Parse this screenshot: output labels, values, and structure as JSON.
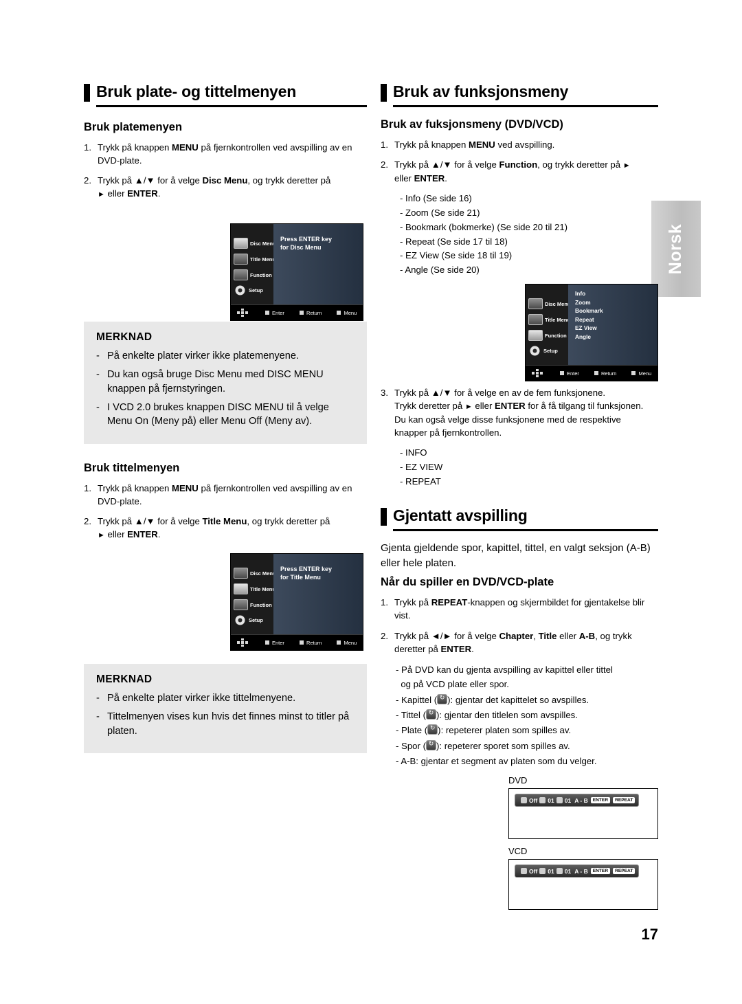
{
  "side_tab": {
    "label": "Norsk"
  },
  "page_number": "17",
  "left": {
    "title": "Bruk plate- og tittelmenyen",
    "sub1": "Bruk platemenyen",
    "steps1": [
      {
        "num": "1.",
        "text": "Trykk på knappen MENU på fjernkontrollen ved avspilling av en DVD-plate.",
        "bold": "MENU"
      },
      {
        "num": "2.",
        "text": "Trykk på ▲/▼ for å velge Disc Menu, og trykk deretter på ► eller ENTER."
      }
    ],
    "osd1": {
      "menu_items": [
        "Disc Menu",
        "Title Menu",
        "Function",
        "Setup"
      ],
      "panel_line1": "Press ENTER key",
      "panel_line2": "for Disc Menu",
      "footer": [
        "Enter",
        "Return",
        "Menu"
      ]
    },
    "note1": {
      "title": "MERKNAD",
      "items": [
        "På enkelte plater virker ikke platemenyene.",
        "Du kan også bruge Disc Menu med DISC MENU knappen på fjernstyringen.",
        "I VCD 2.0 brukes knappen DISC MENU til å velge Menu On (Meny på) eller Menu Off (Meny av)."
      ]
    },
    "sub2": "Bruk tittelmenyen",
    "steps2": [
      {
        "num": "1.",
        "text": "Trykk på knappen MENU på fjernkontrollen ved avspilling av en DVD-plate."
      },
      {
        "num": "2.",
        "text": "Trykk på ▲/▼ for å velge Title Menu, og trykk deretter på ► eller ENTER."
      }
    ],
    "osd2": {
      "menu_items": [
        "Disc Menu",
        "Title Menu",
        "Function",
        "Setup"
      ],
      "panel_line1": "Press ENTER key",
      "panel_line2": "for Title Menu",
      "footer": [
        "Enter",
        "Return",
        "Menu"
      ]
    },
    "note2": {
      "title": "MERKNAD",
      "items": [
        "På enkelte plater virker ikke tittelmenyene.",
        "Tittelmenyen vises kun hvis det finnes minst to titler på platen."
      ]
    }
  },
  "right": {
    "title": "Bruk av funksjonsmeny",
    "sub1": "Bruk av fuksjonsmeny (DVD/VCD)",
    "step1": {
      "num": "1.",
      "text": "Trykk på knappen MENU ved avspilling."
    },
    "step2": {
      "num": "2.",
      "text": "Trykk på ▲/▼ for å velge Function, og trykk deretter på ► eller ENTER."
    },
    "function_list": [
      "- Info (Se side 16)",
      "- Zoom (Se side 21)",
      "- Bookmark (bokmerke) (Se side 20 til 21)",
      "- Repeat (Se side 17 til 18)",
      "- EZ View (Se side 18 til 19)",
      "- Angle (Se side 20)"
    ],
    "osd3": {
      "menu_items": [
        "Disc Menu",
        "Title Menu",
        "Function",
        "Setup"
      ],
      "list_items": [
        "Info",
        "Zoom",
        "Bookmark",
        "Repeat",
        "EZ View",
        "Angle"
      ],
      "footer": [
        "Enter",
        "Return",
        "Menu"
      ]
    },
    "step3": {
      "num": "3.",
      "line1": "Trykk på ▲/▼ for å velge en av de fem funksjonene.",
      "line2": "Trykk deretter på ► eller ENTER for å få tilgang til funksjonen.",
      "line3": "Du kan også velge disse funksjonene med de respektive",
      "line4": "knapper på fjernkontrollen."
    },
    "step3_list": [
      "- INFO",
      "- EZ VIEW",
      "- REPEAT"
    ],
    "title2": "Gjentatt avspilling",
    "intro": "Gjenta gjeldende spor, kapittel, tittel, en valgt seksjon (A-B) eller hele platen.",
    "sub2": "Når du spiller en DVD/VCD-plate",
    "r_step1": {
      "num": "1.",
      "text": "Trykk på REPEAT-knappen og skjermbildet for gjentakelse blir vist."
    },
    "r_step2": {
      "num": "2.",
      "text": "Trykk på ◄/► for å velge Chapter, Title eller A-B, og trykk deretter på ENTER."
    },
    "r_bullets": [
      "- På DVD kan du gjenta avspilling av kapittel eller tittel og på VCD plate eller spor.",
      "- Kapittel (     ): gjentar det kapittelet so avspilles.",
      "- Tittel (     ): gjentar den titlelen som avspilles.",
      "- Plate (     ): repeterer platen som spilles av.",
      "- Spor (     ): repeterer sporet som spilles av.",
      "- A-B: gjentar et segment av platen som du velger."
    ],
    "repeat_dvd": {
      "label": "DVD",
      "segments": [
        "Off",
        "01",
        "01",
        "A - B"
      ],
      "buttons": [
        "ENTER",
        "REPEAT"
      ]
    },
    "repeat_vcd": {
      "label": "VCD",
      "segments": [
        "Off",
        "01",
        "01",
        "A - B"
      ],
      "buttons": [
        "ENTER",
        "REPEAT"
      ]
    }
  }
}
